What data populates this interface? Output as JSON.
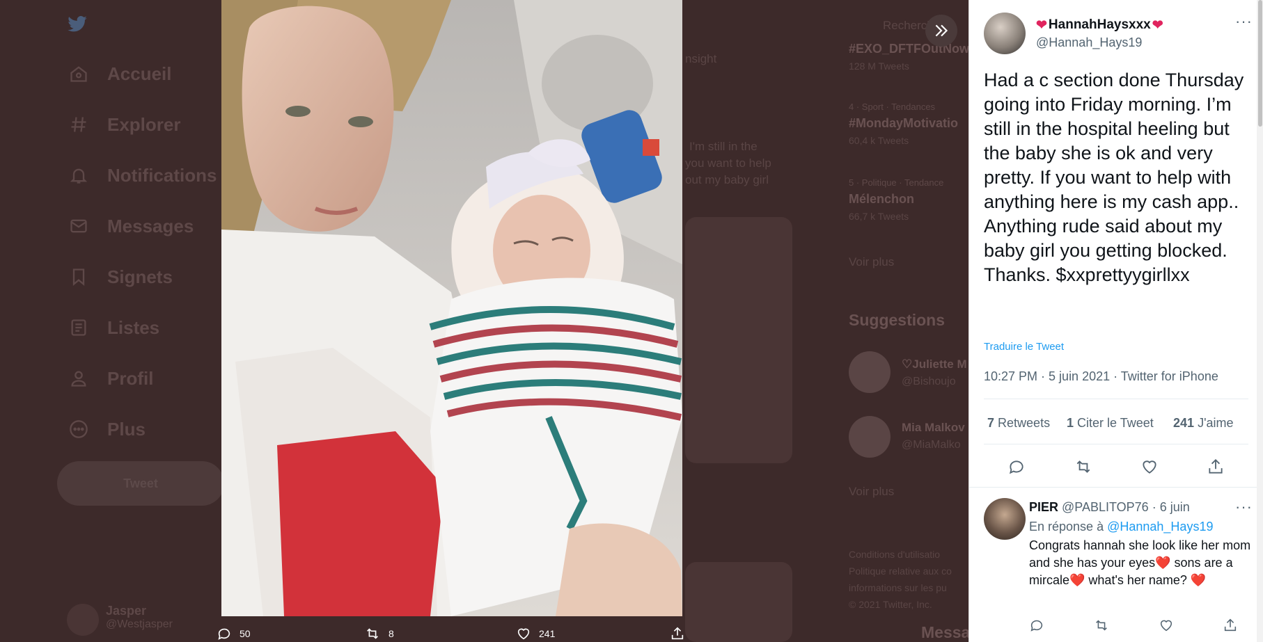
{
  "sidebar": {
    "items": [
      {
        "label": "Accueil",
        "icon": "home-icon"
      },
      {
        "label": "Explorer",
        "icon": "hashtag-icon"
      },
      {
        "label": "Notifications",
        "icon": "bell-icon"
      },
      {
        "label": "Messages",
        "icon": "mail-icon"
      },
      {
        "label": "Signets",
        "icon": "bookmark-icon"
      },
      {
        "label": "Listes",
        "icon": "list-icon"
      },
      {
        "label": "Profil",
        "icon": "user-icon"
      },
      {
        "label": "Plus",
        "icon": "more-circle-icon"
      }
    ],
    "tweet_button": "Tweet",
    "account_name": "Jasper",
    "account_handle": "@Westjasper"
  },
  "background": {
    "search_placeholder": "Recherch",
    "trends": [
      {
        "title": "#EXO_DFTFOutNow",
        "count": "128 M Tweets"
      },
      {
        "head": "4 · Sport · Tendances",
        "title": "#MondayMotivatio",
        "count": "60,4 k Tweets"
      },
      {
        "head": "5 · Politique · Tendance",
        "title": "Mélenchon",
        "count": "66,7 k Tweets"
      }
    ],
    "see_more": "Voir plus",
    "suggestions_title": "Suggestions",
    "suggestions": [
      {
        "name": "♡Juliette M",
        "handle": "@Bishoujo"
      },
      {
        "name": "Mia Malkov",
        "handle": "@MiaMalko"
      }
    ],
    "see_more_2": "Voir plus",
    "ghost_snippets": [
      "nsight",
      "I'm still in the",
      "you want to help",
      "out my baby girl"
    ],
    "footer": [
      "Conditions d'utilisatio",
      "Politique relative aux co",
      "informations sur les pu",
      "© 2021 Twitter, Inc."
    ],
    "messages_label": "Messa"
  },
  "viewer": {
    "bottom_actions": {
      "replies": "50",
      "retweets": "8",
      "likes": "241"
    }
  },
  "tweet": {
    "display_name": "HannahHaysxxx",
    "handle": "@Hannah_Hays19",
    "text": "Had a c section done Thursday going into Friday morning. I’m still in the hospital heeling but the baby she is ok and very pretty. If you want to help with anything here is my cash app.. Anything rude said about my baby girl you getting blocked. Thanks. $xxprettyygirllxx",
    "translate": "Traduire le Tweet",
    "meta": "10:27 PM · 5 juin 2021 · Twitter for iPhone",
    "stats": {
      "retweets_count": "7",
      "retweets_label": "Retweets",
      "quotes_count": "1",
      "quotes_label": "Citer le Tweet",
      "likes_count": "241",
      "likes_label": "J'aime"
    }
  },
  "reply": {
    "name": "PIER",
    "handle": "@PABLITOP76",
    "date": "· 6 juin",
    "in_reply_prefix": "En réponse à",
    "in_reply_handle": "@Hannah_Hays19",
    "text": "Congrats hannah she look like her mom and she has your eyes❤️ sons are a mircale❤️ what's her name? ❤️"
  },
  "colors": {
    "accent": "#1d9bf0",
    "heart": "#e0245e",
    "overlay": "#3d2a2a"
  }
}
